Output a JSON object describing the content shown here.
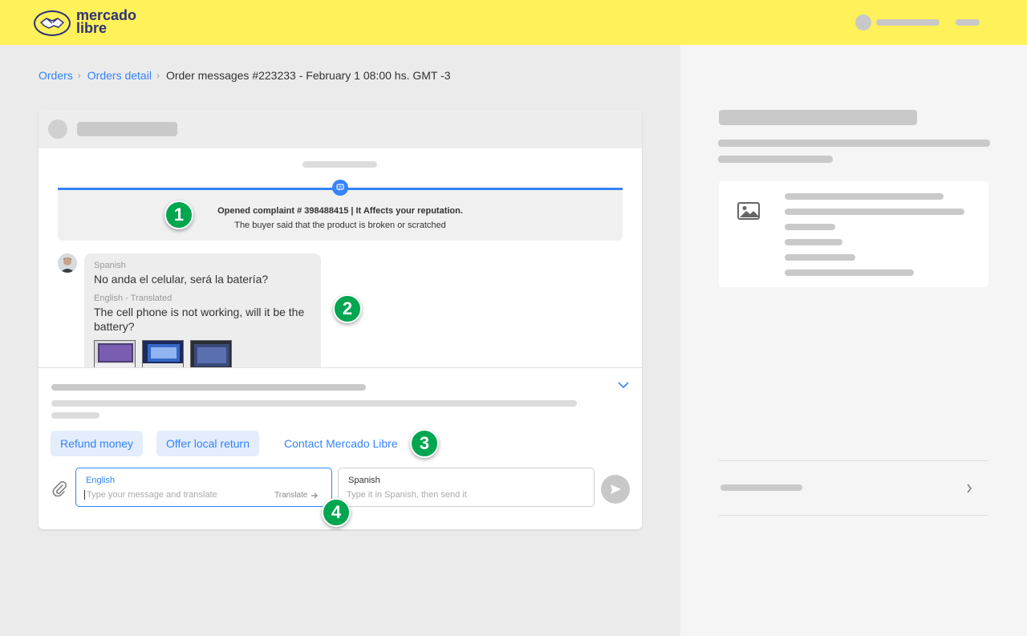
{
  "header": {
    "logo_line1": "mercado",
    "logo_line2": "libre"
  },
  "breadcrumb": {
    "items": [
      {
        "label": "Orders"
      },
      {
        "label": "Orders detail"
      }
    ],
    "current": "Order messages #223233 - February 1 08:00 hs. GMT -3"
  },
  "complaint": {
    "title": "Opened complaint # 398488415 | It Affects your reputation.",
    "description": "The buyer said that the product is broken or scratched"
  },
  "message": {
    "original_lang": "Spanish",
    "original_text": "No anda el celular, será la batería?",
    "translated_lang": "English - Translated",
    "translated_text": "The cell phone is not working, will it be the battery?"
  },
  "actions": {
    "refund": "Refund money",
    "offer_return": "Offer local return",
    "contact": "Contact Mercado Libre"
  },
  "composer": {
    "source_label": "English",
    "source_placeholder": "Type your message and translate",
    "translate_label": "Translate",
    "target_label": "Spanish",
    "target_placeholder": "Type it in Spanish, then send it"
  },
  "badges": {
    "b1": "1",
    "b2": "2",
    "b3": "3",
    "b4": "4"
  },
  "colors": {
    "brand_yellow": "#fff159",
    "accent_blue": "#3483fa",
    "badge_green": "#00a650"
  }
}
